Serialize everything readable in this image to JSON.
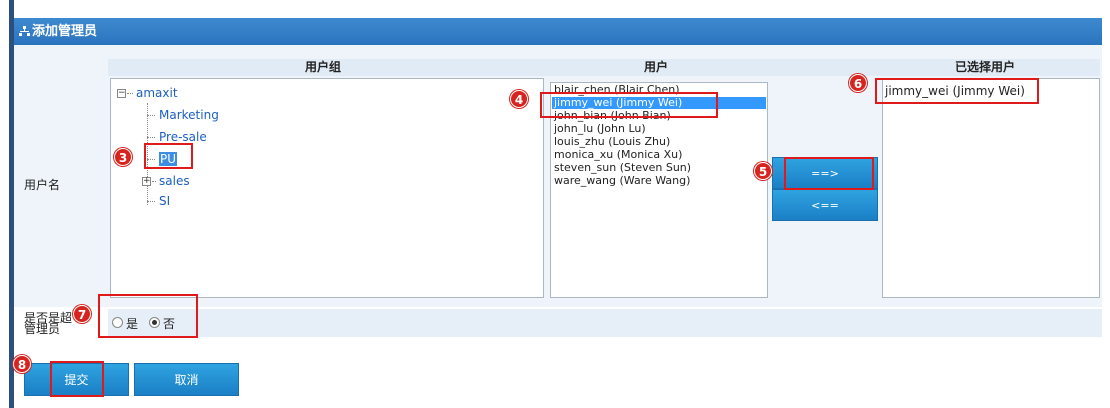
{
  "page": {
    "title": "添加管理员"
  },
  "columns": {
    "groups": "用户组",
    "users": "用户",
    "selected": "已选择用户"
  },
  "labels": {
    "username": "用户名",
    "is_admin_line1": "是否是超",
    "is_admin_line2": "管理员"
  },
  "tree": {
    "root": "amaxit",
    "children": [
      "Marketing",
      "Pre-sale",
      "PU",
      "sales",
      "SI"
    ],
    "selected": "PU"
  },
  "users": [
    "blair_chen (Blair Chen)",
    "jimmy_wei (Jimmy Wei)",
    "john_bian (John Bian)",
    "john_lu (John Lu)",
    "louis_zhu (Louis Zhu)",
    "monica_xu (Monica Xu)",
    "steven_sun (Steven Sun)",
    "ware_wang (Ware Wang)"
  ],
  "selected_user_index": 1,
  "selected_users": [
    "jimmy_wei (Jimmy Wei)"
  ],
  "buttons": {
    "add": "==>",
    "remove": "<==",
    "submit": "提交",
    "cancel": "取消"
  },
  "radio": {
    "yes": "是",
    "no": "否",
    "checked": "no"
  },
  "badges": [
    "3",
    "4",
    "5",
    "6",
    "7",
    "8"
  ],
  "colors": {
    "title_bar": "#2a74bd",
    "highlight": "#e01a1a",
    "selection": "#3399ff"
  }
}
